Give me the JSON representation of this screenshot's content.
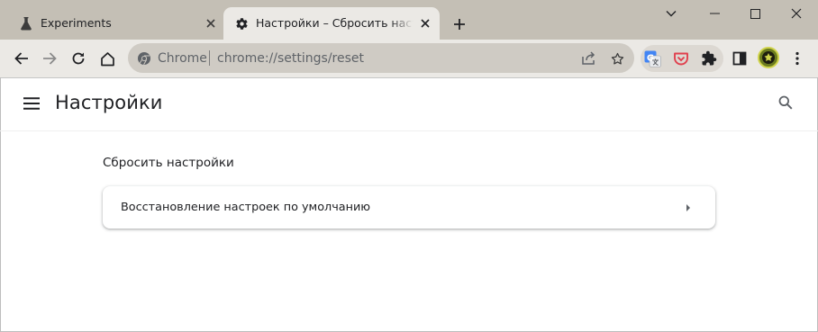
{
  "tabs": [
    {
      "title": "Experiments",
      "icon": "flask-icon",
      "active": false
    },
    {
      "title": "Настройки – Сбросить настройки",
      "icon": "gear-icon",
      "active": true
    }
  ],
  "omnibox": {
    "site_label": "Chrome",
    "url": "chrome://settings/reset"
  },
  "page": {
    "title": "Настройки",
    "section_title": "Сбросить настройки",
    "reset_item_label": "Восстановление настроек по умолчанию"
  },
  "colors": {
    "tabstrip_bg": "#c4bfb5",
    "toolbar_bg": "#ebe9e5",
    "omnibox_bg": "#cfcbc4",
    "pocket_red": "#e0404e",
    "translate_blue": "#4285f4"
  }
}
